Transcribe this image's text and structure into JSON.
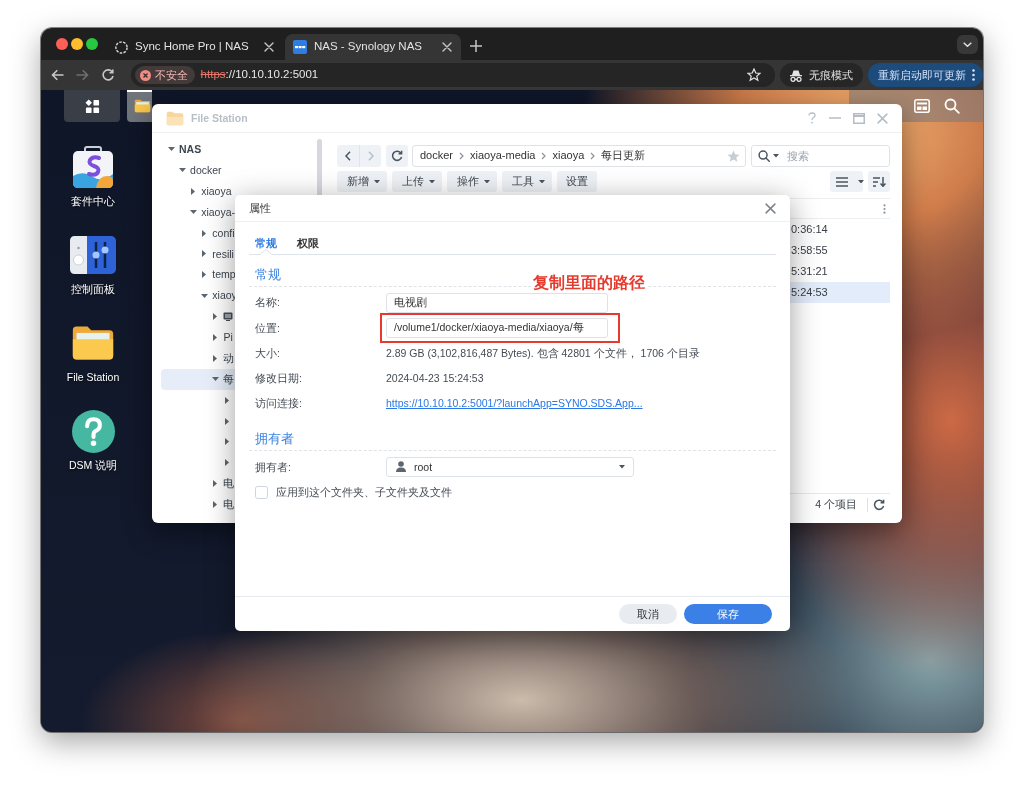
{
  "browser": {
    "tabs": [
      {
        "title": "Sync Home Pro | NAS",
        "kind": "ring",
        "selected": false
      },
      {
        "title": "NAS - Synology NAS",
        "kind": "logo",
        "selected": true
      }
    ],
    "nav_buttons": [
      {
        "kind": "back",
        "disabled": false
      },
      {
        "kind": "forward",
        "disabled": true
      },
      {
        "kind": "reload",
        "disabled": false
      }
    ],
    "address": {
      "security_label": "不安全",
      "scheme": "https",
      "rest": "://10.10.10.2:5001"
    },
    "incognito_label": "无痕模式",
    "update_label": "重新启动即可更新"
  },
  "desktop": {
    "taskbar_apps": [
      {
        "kind": "folder",
        "open": true
      }
    ],
    "shortcuts": [
      {
        "label": "套件中心",
        "kind": "bag"
      },
      {
        "label": "控制面板",
        "kind": "sliders"
      },
      {
        "label": "File Station",
        "kind": "folder"
      },
      {
        "label": "DSM 说明",
        "kind": "help"
      }
    ]
  },
  "file_station": {
    "title": "File Station",
    "active": false,
    "tree": [
      {
        "label": "NAS",
        "expanded": true,
        "selected": false,
        "children": [
          {
            "label": "docker",
            "expanded": true,
            "selected": false,
            "children": [
              {
                "label": "xiaoya",
                "expanded": false,
                "selected": false
              },
              {
                "label": "xiaoya-",
                "expanded": true,
                "selected": false,
                "children": [
                  {
                    "label": "confi",
                    "expanded": false,
                    "selected": false
                  },
                  {
                    "label": "resili",
                    "expanded": false,
                    "selected": false
                  },
                  {
                    "label": "temp",
                    "expanded": false,
                    "selected": false
                  },
                  {
                    "label": "xiaoy",
                    "expanded": true,
                    "selected": false,
                    "children": [
                      {
                        "kind": "tv",
                        "expanded": false,
                        "selected": false
                      },
                      {
                        "kind": "text",
                        "label": "Pi",
                        "expanded": false,
                        "selected": false
                      },
                      {
                        "kind": "text",
                        "label": "动",
                        "expanded": false,
                        "selected": false
                      },
                      {
                        "kind": "text",
                        "label": "每",
                        "expanded": true,
                        "selected": true,
                        "children": [
                          {
                            "expanded": false,
                            "selected": false
                          },
                          {
                            "expanded": false,
                            "selected": false
                          },
                          {
                            "expanded": false,
                            "selected": false
                          },
                          {
                            "expanded": false,
                            "selected": false
                          }
                        ]
                      },
                      {
                        "kind": "text",
                        "label": "电",
                        "expanded": false,
                        "selected": false
                      },
                      {
                        "kind": "text",
                        "label": "电",
                        "expanded": false,
                        "selected": false
                      }
                    ]
                  }
                ]
              }
            ]
          }
        ]
      }
    ],
    "nav": {
      "back_disabled": false,
      "forward_disabled": true
    },
    "path": [
      "docker",
      "xiaoya-media",
      "xiaoya",
      "每日更新"
    ],
    "search_placeholder": "搜索",
    "actions": [
      {
        "label": "新增",
        "dropdown": true
      },
      {
        "label": "上传",
        "dropdown": true
      },
      {
        "label": "操作",
        "dropdown": true
      },
      {
        "label": "工具",
        "dropdown": true
      },
      {
        "label": "设置",
        "dropdown": false
      }
    ],
    "rows": [
      {
        "time": "0:36:14",
        "selected": false
      },
      {
        "time": "3:58:55",
        "selected": false
      },
      {
        "time": "5:31:21",
        "selected": false
      },
      {
        "time": "5:24:53",
        "selected": true
      }
    ],
    "status": "4 个项目"
  },
  "properties_dialog": {
    "title": "属性",
    "tabs": [
      {
        "label": "常规",
        "selected": true
      },
      {
        "label": "权限",
        "selected": false
      }
    ],
    "sections": [
      {
        "heading": "常规",
        "fields": [
          {
            "label": "名称:",
            "kind": "input",
            "value": "电视剧",
            "highlighted": false
          },
          {
            "label": "位置:",
            "kind": "input",
            "value": "/volume1/docker/xiaoya-media/xiaoya/每",
            "highlighted": true
          },
          {
            "label": "大小:",
            "kind": "text",
            "value": "2.89 GB (3,102,816,487 Bytes). 包含 42801 个文件， 1706 个目录",
            "highlighted": false
          },
          {
            "label": "修改日期:",
            "kind": "text",
            "value": "2024-04-23 15:24:53",
            "highlighted": false
          },
          {
            "label": "访问连接:",
            "kind": "link",
            "value": "https://10.10.10.2:5001/?launchApp=SYNO.SDS.App...",
            "highlighted": false
          }
        ]
      },
      {
        "heading": "拥有者",
        "fields": [
          {
            "label": "拥有者:",
            "kind": "select",
            "value": "root",
            "highlighted": false
          }
        ]
      }
    ],
    "apply_checkbox": {
      "label": "应用到这个文件夹、子文件夹及文件",
      "checked": false
    },
    "buttons": [
      {
        "label": "取消",
        "kind": "secondary"
      },
      {
        "label": "保存",
        "kind": "primary"
      }
    ]
  },
  "annotation": {
    "text": "复制里面的路径"
  }
}
